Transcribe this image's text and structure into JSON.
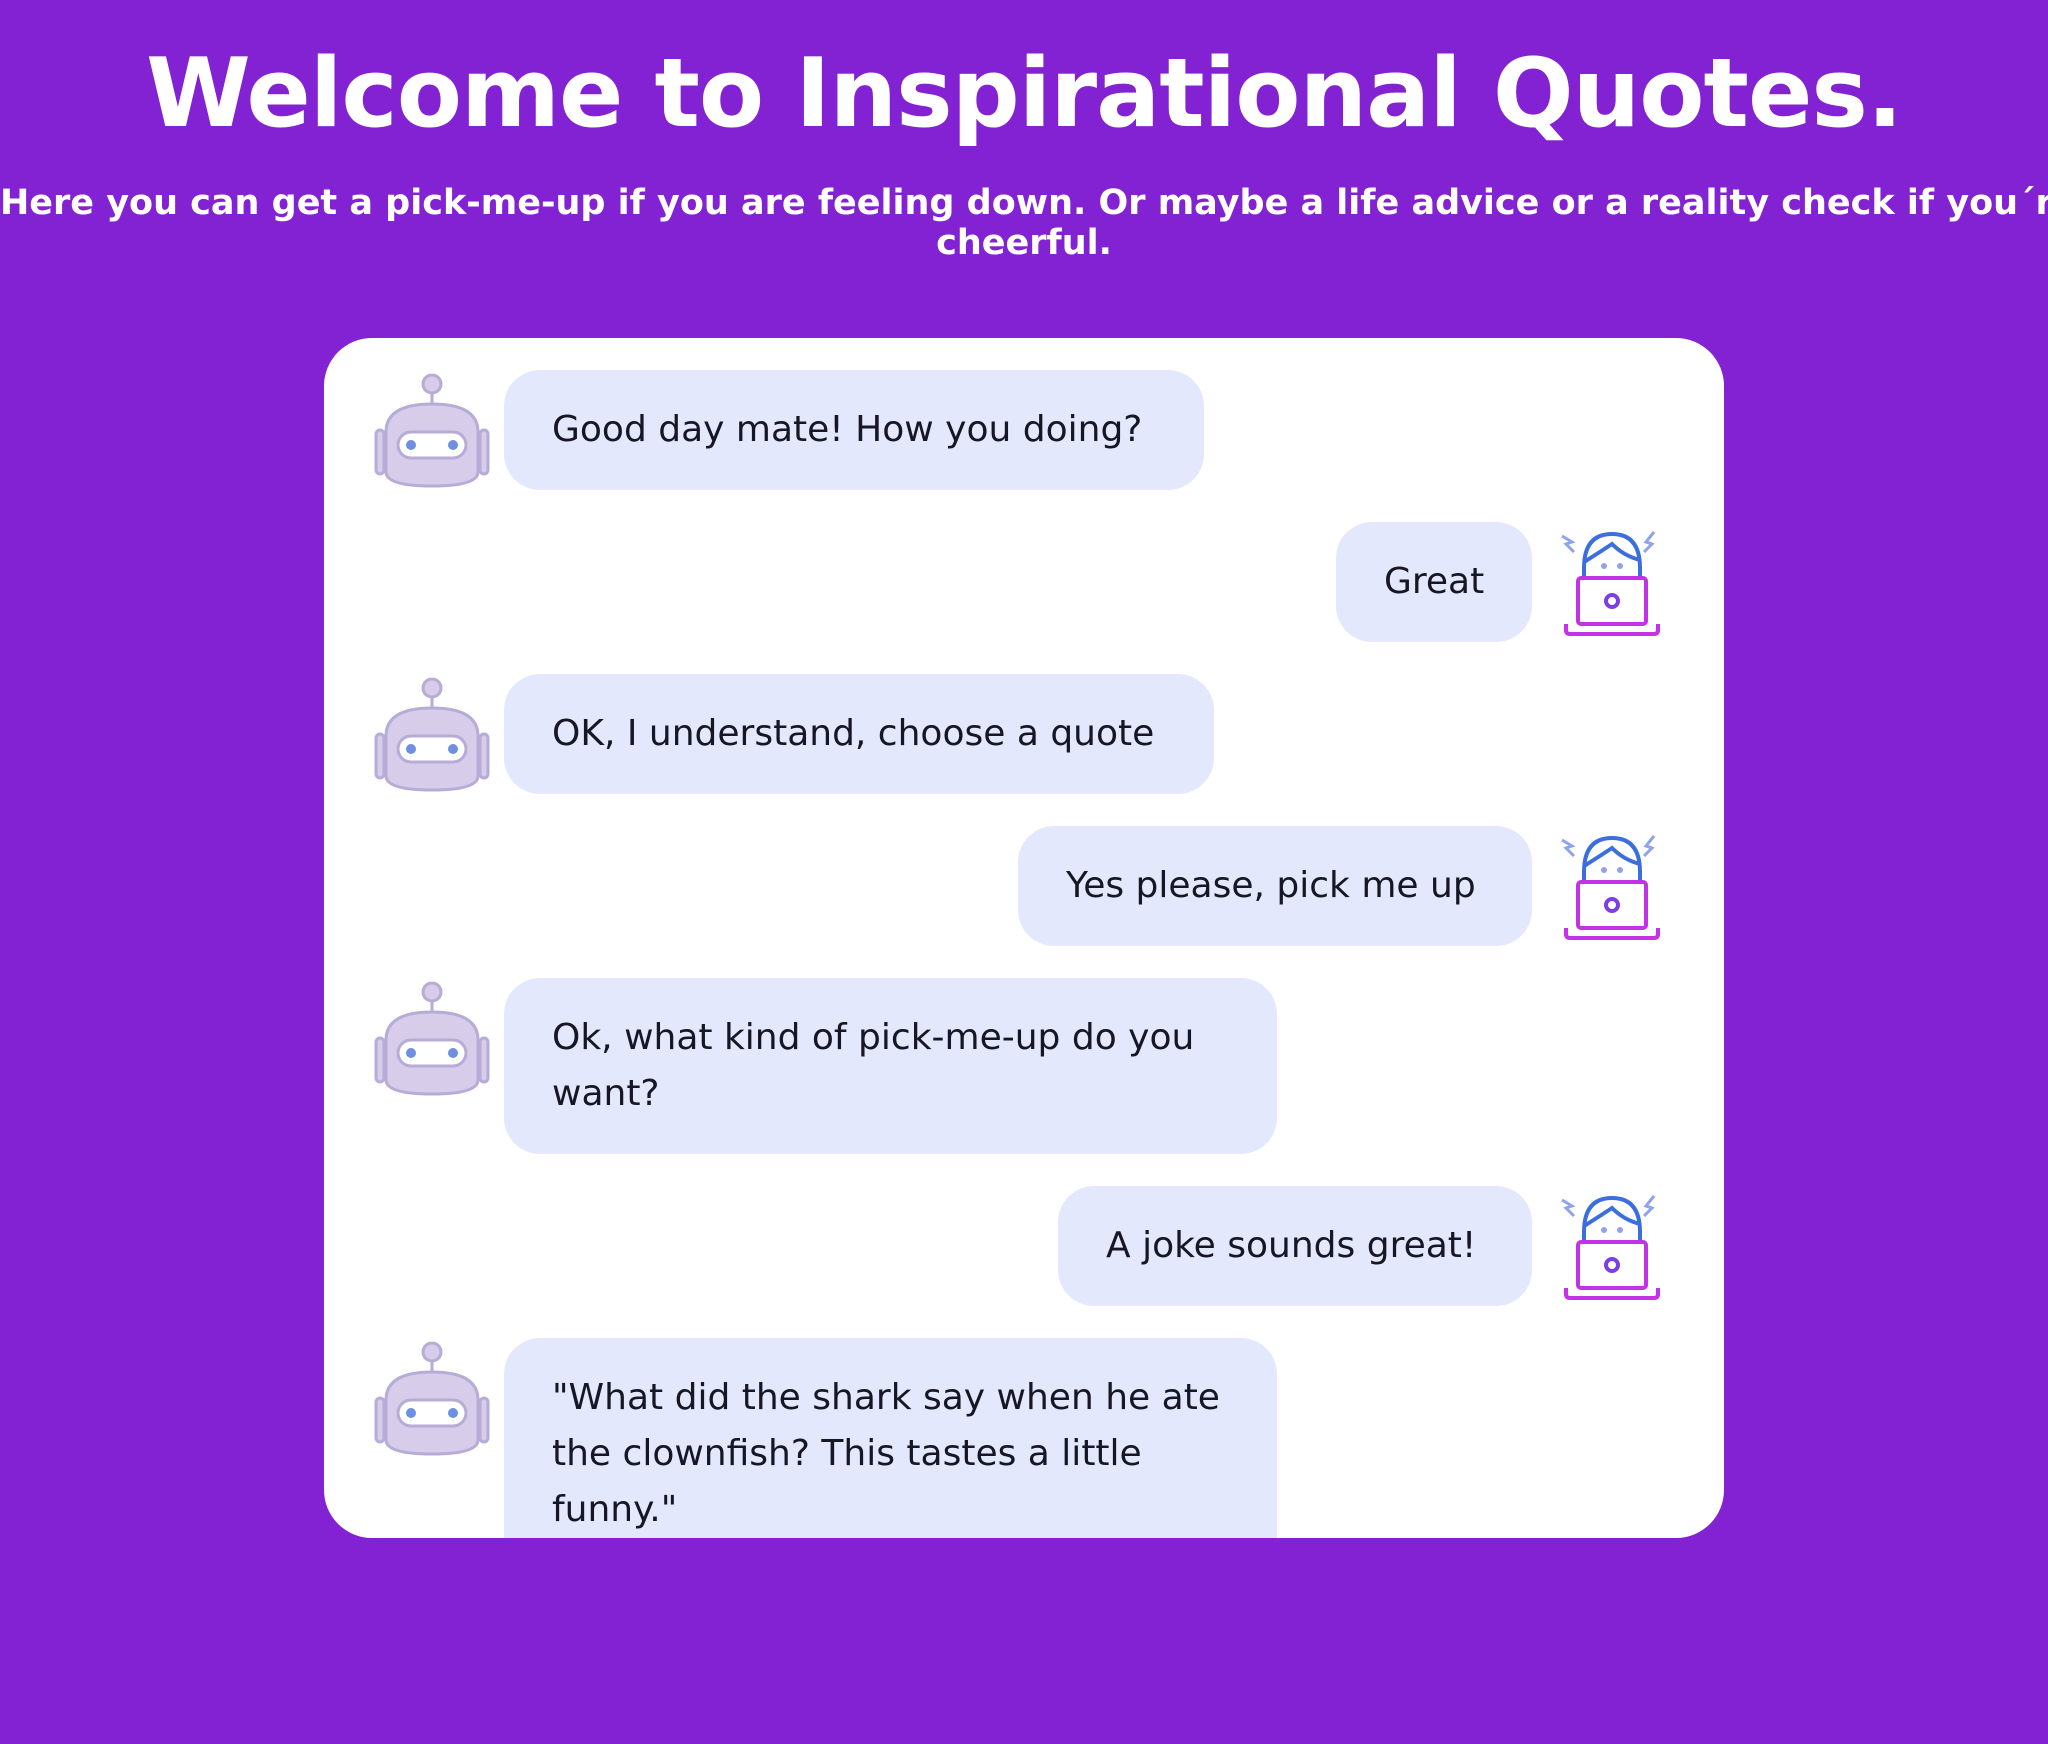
{
  "header": {
    "title": "Welcome to Inspirational Quotes.",
    "subtitle_line1": "Here you can get a pick-me-up if you are feeling down. Or maybe a life advice or a reality check if you´re too",
    "subtitle_line2": "cheerful."
  },
  "chat": {
    "messages": [
      {
        "sender": "bot",
        "avatar_icon": "robot-icon",
        "text": "Good day mate! How you doing?"
      },
      {
        "sender": "user",
        "avatar_icon": "user-laptop-icon",
        "text": "Great"
      },
      {
        "sender": "bot",
        "avatar_icon": "robot-icon",
        "text": "OK, I understand, choose a quote"
      },
      {
        "sender": "user",
        "avatar_icon": "user-laptop-icon",
        "text": "Yes please, pick me up"
      },
      {
        "sender": "bot",
        "avatar_icon": "robot-icon",
        "text": "Ok, what kind of pick-me-up do you want?"
      },
      {
        "sender": "user",
        "avatar_icon": "user-laptop-icon",
        "text": "A joke sounds great!"
      },
      {
        "sender": "bot",
        "avatar_icon": "robot-icon",
        "text": "\"What did the shark say when he ate the clownfish? This tastes a little funny.\""
      }
    ]
  },
  "colors": {
    "background": "#8322d2",
    "chat_panel": "#ffffff",
    "bubble": "#e4e8fc",
    "text_dark": "#161624"
  }
}
